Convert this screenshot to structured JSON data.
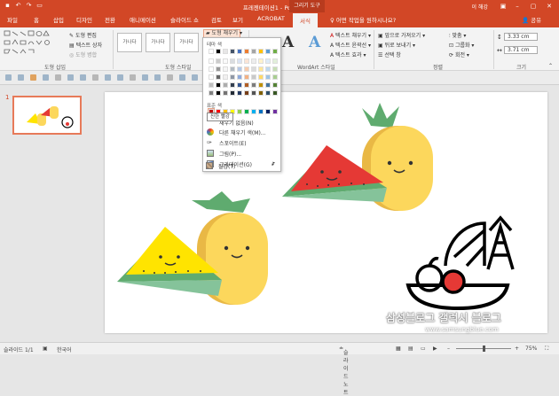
{
  "window": {
    "title": "프레젠테이션1 - PowerPoint",
    "context_tab": "그리기 도구",
    "user": "이 해강"
  },
  "tabs": [
    {
      "label": "파일"
    },
    {
      "label": "홈"
    },
    {
      "label": "삽입"
    },
    {
      "label": "디자인"
    },
    {
      "label": "전환"
    },
    {
      "label": "애니메이션"
    },
    {
      "label": "슬라이드 쇼"
    },
    {
      "label": "검토"
    },
    {
      "label": "보기"
    },
    {
      "label": "ACROBAT"
    },
    {
      "label": "서식"
    }
  ],
  "tell_me": "어떤 작업을 원하시나요?",
  "share": "공유",
  "ribbon": {
    "insert_shapes": {
      "edit_shape": "도형 편집",
      "text_box": "텍스트 상자",
      "merge_shapes": "도형 병합",
      "label": "도형 삽입"
    },
    "shape_styles": {
      "preview_text": "가나다",
      "label": "도형 스타일",
      "fill_button": "도형 채우기"
    },
    "wordart": {
      "label": "WordArt 스타일",
      "text_fill": "텍스트 채우기",
      "text_outline": "텍스트 윤곽선",
      "text_effects": "텍스트 효과"
    },
    "arrange": {
      "bring_forward": "앞으로 가져오기",
      "send_backward": "뒤로 보내기",
      "selection_pane": "선택 창",
      "align": "맞춤",
      "group": "그룹화",
      "rotate": "회전",
      "label": "정렬"
    },
    "size": {
      "height": "3.33 cm",
      "width": "3.71 cm",
      "label": "크기"
    }
  },
  "dropdown": {
    "theme_colors_label": "테마 색",
    "standard_colors_label": "표준 색",
    "no_fill": "채우기 없음(N)",
    "more_fill_colors": "다른 채우기 색(M)...",
    "eyedropper": "스포이트(E)",
    "picture": "그림(P)...",
    "gradient": "그라데이션(G)",
    "texture": "질감(T)",
    "tooltip": "진한 빨강",
    "theme_row": [
      "#ffffff",
      "#000000",
      "#e7e6e6",
      "#44546a",
      "#4472c4",
      "#ed7d31",
      "#a5a5a5",
      "#ffc000",
      "#5b9bd5",
      "#70ad47"
    ],
    "standard_row": [
      "#c00000",
      "#ff0000",
      "#ffc000",
      "#ffff00",
      "#92d050",
      "#00b050",
      "#00b0f0",
      "#0070c0",
      "#002060",
      "#7030a0"
    ]
  },
  "thumbnail": {
    "number": "1"
  },
  "status": {
    "slide": "슬라이드 1/1",
    "language": "한국어",
    "notes": "슬라이드 노트",
    "zoom": "75%"
  },
  "watermark": {
    "title": "삼성블로그 갤럭시 블로그",
    "url": "www.samsungblue.com"
  }
}
